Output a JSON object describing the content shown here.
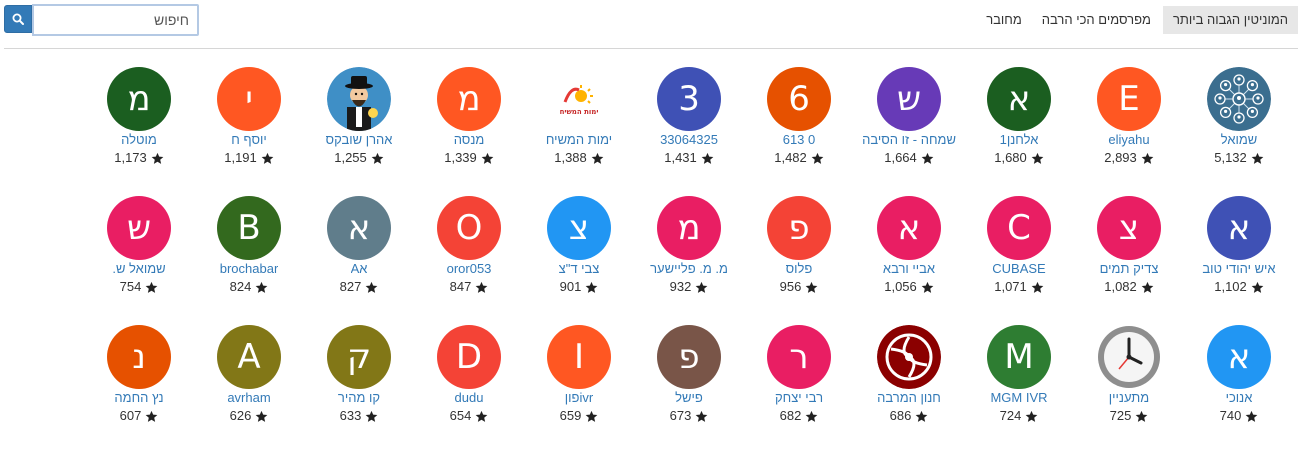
{
  "search": {
    "placeholder": "חיפוש",
    "button_icon": "search-icon"
  },
  "nav": {
    "items": [
      {
        "label": "מחובר"
      },
      {
        "label": "מפרסמים הכי הרבה"
      },
      {
        "label": "המוניטין הגבוה ביותר",
        "active": true
      }
    ]
  },
  "users": [
    {
      "letter": "",
      "icon": "network-people-icon",
      "color": "#3b6e8f",
      "name": "שמואל",
      "reputation": "5,132"
    },
    {
      "letter": "E",
      "color": "#ff5722",
      "name": "eliyahu",
      "reputation": "2,893"
    },
    {
      "letter": "א",
      "color": "#1b5e20",
      "name": "אלחנן1",
      "reputation": "1,680"
    },
    {
      "letter": "ש",
      "color": "#673ab7",
      "name": "שמחה - זו הסיבה",
      "reputation": "1,664"
    },
    {
      "letter": "6",
      "color": "#e65100",
      "name": "0 613",
      "reputation": "1,482"
    },
    {
      "letter": "3",
      "color": "#3f51b5",
      "name": "33064325",
      "reputation": "1,431"
    },
    {
      "letter": "",
      "icon": "sun-logo-icon",
      "logo_text": "ימות המשיח",
      "color": "#ffffff",
      "name": "ימות המשיח",
      "reputation": "1,388"
    },
    {
      "letter": "מ",
      "color": "#ff5722",
      "name": "מנסה",
      "reputation": "1,339"
    },
    {
      "letter": "",
      "icon": "cartoon-rabbi-icon",
      "color": "#3f8fc6",
      "name": "אהרן שובקס",
      "reputation": "1,255"
    },
    {
      "letter": "י",
      "color": "#ff5722",
      "name": "יוסף ח",
      "reputation": "1,191"
    },
    {
      "letter": "מ",
      "color": "#1b5e20",
      "name": "מוטלה",
      "reputation": "1,173"
    },
    {
      "letter": "א",
      "color": "#3f51b5",
      "name": "איש יהודי טוב",
      "reputation": "1,102"
    },
    {
      "letter": "צ",
      "color": "#e91e63",
      "name": "צדיק תמים",
      "reputation": "1,082"
    },
    {
      "letter": "C",
      "color": "#e91e63",
      "name": "CUBASE",
      "reputation": "1,071"
    },
    {
      "letter": "א",
      "color": "#e91e63",
      "name": "אביי ורבא",
      "reputation": "1,056"
    },
    {
      "letter": "פ",
      "color": "#f44336",
      "name": "פלוס",
      "reputation": "956"
    },
    {
      "letter": "מ",
      "color": "#e91e63",
      "name": "מ. מ. פליישער",
      "reputation": "932"
    },
    {
      "letter": "צ",
      "color": "#2196f3",
      "name": "צבי ד\"צ",
      "reputation": "901"
    },
    {
      "letter": "O",
      "color": "#f44336",
      "name": "oror053",
      "reputation": "847"
    },
    {
      "letter": "א",
      "color": "#607d8b",
      "name": "אA",
      "reputation": "827"
    },
    {
      "letter": "B",
      "color": "#33691e",
      "name": "brochabar",
      "reputation": "824"
    },
    {
      "letter": "ש",
      "color": "#e91e63",
      "name": "שמואל ש.",
      "reputation": "754"
    },
    {
      "letter": "א",
      "color": "#2196f3",
      "name": "אנוכי",
      "reputation": "740"
    },
    {
      "letter": "",
      "icon": "clock-icon",
      "color": "#9e9e9e",
      "name": "מתעניין",
      "reputation": "725"
    },
    {
      "letter": "M",
      "color": "#2e7d32",
      "name": "MGM IVR",
      "reputation": "724"
    },
    {
      "letter": "",
      "icon": "red-emblem-icon",
      "color": "#8b0000",
      "name": "חנון המרבה",
      "reputation": "686"
    },
    {
      "letter": "ר",
      "color": "#e91e63",
      "name": "רבי יצחק",
      "reputation": "682"
    },
    {
      "letter": "פ",
      "color": "#795548",
      "name": "פישל",
      "reputation": "673"
    },
    {
      "letter": "I",
      "color": "#ff5722",
      "name": "ivrפון",
      "reputation": "659"
    },
    {
      "letter": "D",
      "color": "#f44336",
      "name": "dudu",
      "reputation": "654"
    },
    {
      "letter": "ק",
      "color": "#827717",
      "name": "קו מהיר",
      "reputation": "633"
    },
    {
      "letter": "A",
      "color": "#827717",
      "name": "avrham",
      "reputation": "626"
    },
    {
      "letter": "נ",
      "color": "#e65100",
      "name": "נץ החמה",
      "reputation": "607"
    }
  ]
}
